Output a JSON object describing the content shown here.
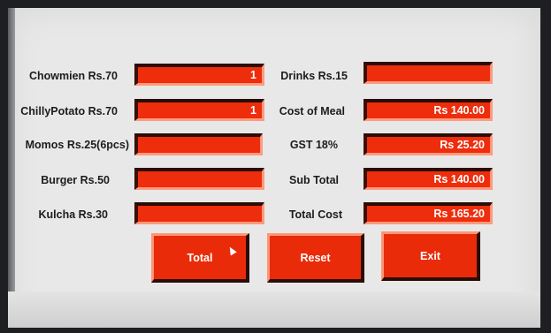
{
  "menu": [
    {
      "item": "Chowmien  Rs.70",
      "qty": "1"
    },
    {
      "item": "ChillyPotato Rs.70",
      "qty": "1"
    },
    {
      "item": "Momos  Rs.25(6pcs)",
      "qty": ""
    },
    {
      "item": "Burger Rs.50",
      "qty": ""
    },
    {
      "item": "Kulcha  Rs.30",
      "qty": ""
    }
  ],
  "summary": [
    {
      "label": "Drinks  Rs.15",
      "value": ""
    },
    {
      "label": "Cost of Meal",
      "value": "Rs 140.00"
    },
    {
      "label": "GST 18%",
      "value": "Rs 25.20"
    },
    {
      "label": "Sub Total",
      "value": "Rs 140.00"
    },
    {
      "label": "Total Cost",
      "value": "Rs 165.20"
    }
  ],
  "buttons": {
    "total": "Total",
    "reset": "Reset",
    "exit": "Exit"
  },
  "colors": {
    "field_red": "#ee2d0c",
    "background": "#e8e8e8"
  }
}
